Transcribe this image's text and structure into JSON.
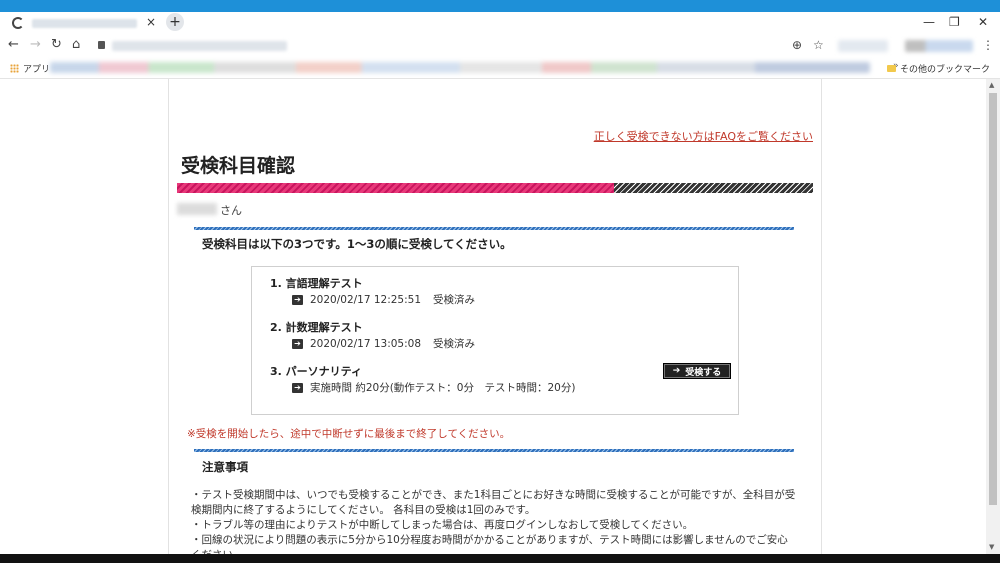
{
  "browser": {
    "tab_close": "×",
    "new_tab": "+",
    "window_controls": {
      "minimize": "—",
      "restore": "❐",
      "close": "✕"
    },
    "nav": {
      "back": "←",
      "forward": "→",
      "reload": "↻",
      "home": "⌂"
    },
    "zoom_icon": "⊕",
    "star_icon": "☆",
    "menu_icon": "⋮",
    "bookmarks": {
      "apps_label": "アプリ",
      "more_chevron": "»",
      "other_label": "その他のブックマーク"
    }
  },
  "page": {
    "faq_link": "正しく受検できない方はFAQをご覧ください",
    "title": "受検科目確認",
    "user_suffix": "さん",
    "intro": "受検科目は以下の3つです。1～3の順に受検してください。",
    "subjects": [
      {
        "name": "1. 言語理解テスト",
        "detail": "2020/02/17 12:25:51",
        "status": "受検済み"
      },
      {
        "name": "2. 計数理解テスト",
        "detail": "2020/02/17 13:05:08",
        "status": "受検済み"
      },
      {
        "name": "3. パーソナリティ",
        "detail": "実施時間 約20分(動作テスト：0分　テスト時間：20分)",
        "status": ""
      }
    ],
    "exam_button": "受検する",
    "warning": "※受検を開始したら、途中で中断せずに最後まで終了してください。",
    "notes_heading": "注意事項",
    "notes": [
      "・テスト受検期間中は、いつでも受検することができ、また1科目ごとにお好きな時間に受検することが可能ですが、全科目が受",
      "検期間内に終了するようにしてください。 各科目の受検は1回のみです。",
      "・トラブル等の理由によりテストが中断してしまった場合は、再度ログインしなおして受検してください。",
      "・回線の状況により問題の表示に5分から10分程度お時間がかかることがありますが、テスト時間には影響しませんのでご安心",
      "ください。"
    ]
  },
  "colors": {
    "accent_blue": "#1e90d8",
    "link_red": "#c0392b",
    "stripe_pink": "#e8397a"
  }
}
